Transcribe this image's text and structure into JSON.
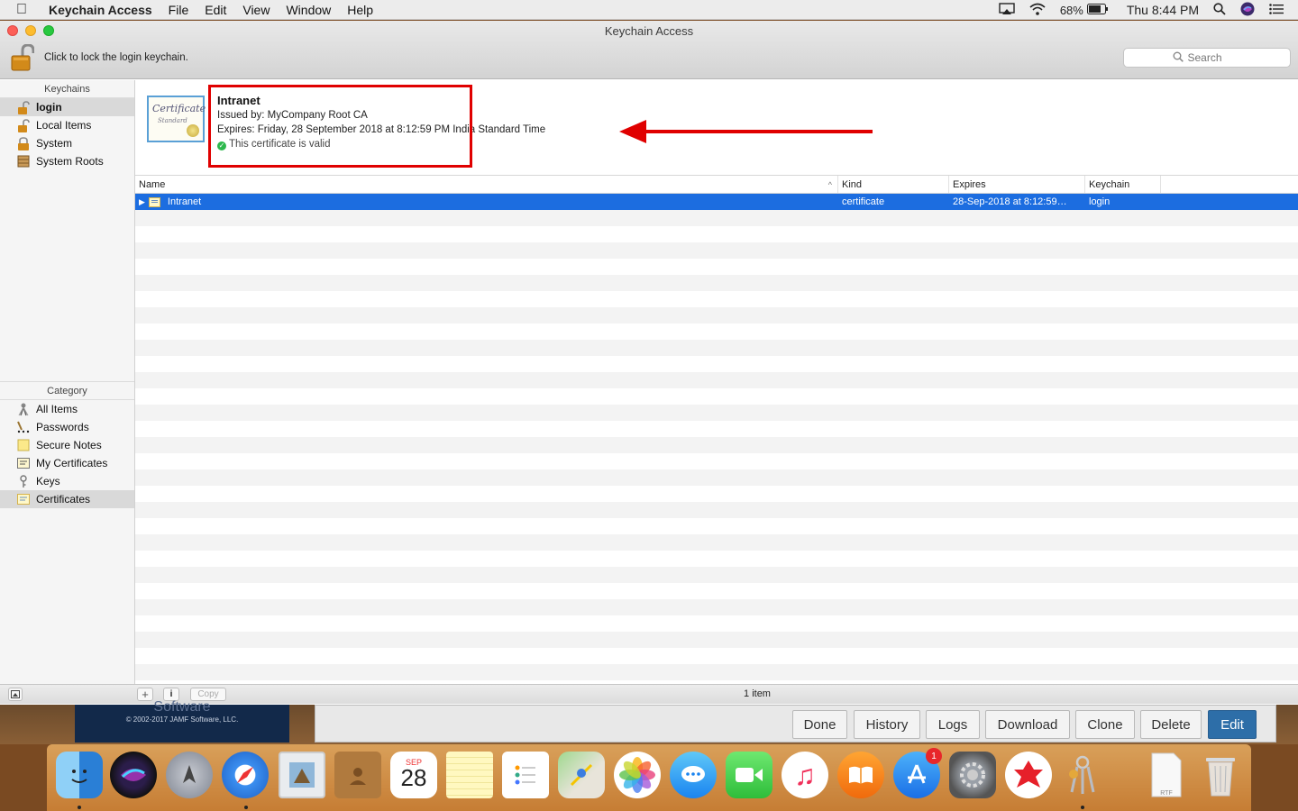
{
  "menubar": {
    "app_name": "Keychain Access",
    "menus": [
      "File",
      "Edit",
      "View",
      "Window",
      "Help"
    ],
    "battery": "68%",
    "clock": "Thu 8:44 PM"
  },
  "window": {
    "title": "Keychain Access",
    "lock_label": "Click to lock the login keychain.",
    "search_placeholder": "Search"
  },
  "sidebar": {
    "keychains_header": "Keychains",
    "keychains": [
      {
        "label": "login",
        "icon": "unlocked-padlock-icon",
        "selected": true
      },
      {
        "label": "Local Items",
        "icon": "unlocked-padlock-icon"
      },
      {
        "label": "System",
        "icon": "locked-padlock-icon"
      },
      {
        "label": "System Roots",
        "icon": "cabinet-icon"
      }
    ],
    "category_header": "Category",
    "categories": [
      {
        "label": "All Items",
        "icon": "all-items-icon"
      },
      {
        "label": "Passwords",
        "icon": "password-icon"
      },
      {
        "label": "Secure Notes",
        "icon": "note-icon"
      },
      {
        "label": "My Certificates",
        "icon": "my-certificate-icon"
      },
      {
        "label": "Keys",
        "icon": "key-icon"
      },
      {
        "label": "Certificates",
        "icon": "certificate-icon",
        "selected": true
      }
    ]
  },
  "detail": {
    "name": "Intranet",
    "issued_by": "Issued by: MyCompany Root CA",
    "expires": "Expires: Friday, 28 September 2018 at 8:12:59 PM India Standard Time",
    "validity": "This certificate is valid",
    "badge_text_1": "Certificate",
    "badge_text_2": "Standard"
  },
  "table": {
    "columns": [
      "Name",
      "Kind",
      "Expires",
      "Keychain"
    ],
    "rows": [
      {
        "name": "Intranet",
        "kind": "certificate",
        "expires": "28-Sep-2018 at 8:12:59…",
        "keychain": "login"
      }
    ]
  },
  "bottombar": {
    "copy_label": "Copy",
    "info_label": "i",
    "add_label": "+",
    "status": "1 item"
  },
  "background_app": {
    "brand": "Software",
    "copyright": "© 2002-2017 JAMF Software, LLC.",
    "buttons": [
      "Done",
      "History",
      "Logs",
      "Download",
      "Clone",
      "Delete",
      "Edit"
    ]
  },
  "dock": {
    "calendar_month": "SEP",
    "calendar_day": "28",
    "app_store_badge": "1",
    "rtf_label": "RTF"
  },
  "colors": {
    "selection": "#1c6de0",
    "highlight_annotation": "#e00000",
    "valid_green": "#2db84d"
  }
}
